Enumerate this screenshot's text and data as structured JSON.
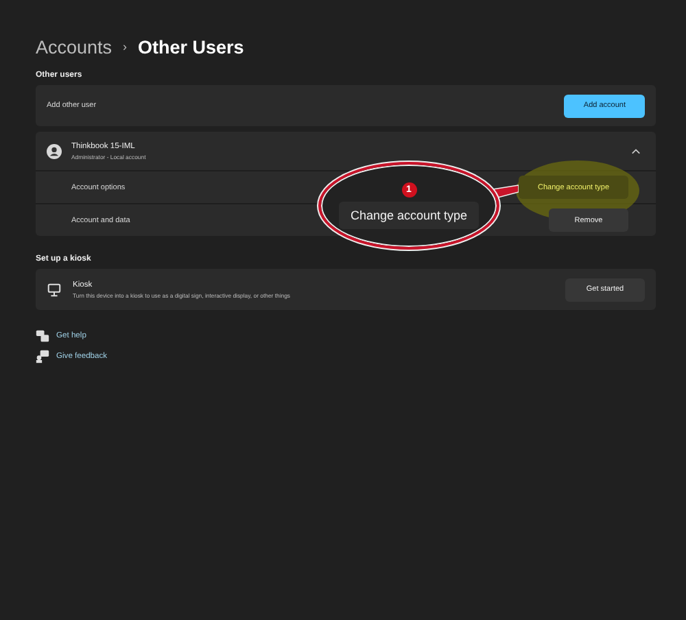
{
  "breadcrumb": {
    "parent": "Accounts",
    "separator": "›",
    "current": "Other Users"
  },
  "other_users": {
    "heading": "Other users",
    "add_row": {
      "label": "Add other user",
      "button": "Add account"
    },
    "user": {
      "name": "Thinkbook 15-IML",
      "subtitle": "Administrator - Local account",
      "expanded": true,
      "rows": [
        {
          "label": "Account options",
          "button": "Change account type",
          "highlighted": true
        },
        {
          "label": "Account and data",
          "button": "Remove",
          "highlighted": false
        }
      ]
    }
  },
  "kiosk": {
    "heading": "Set up a kiosk",
    "title": "Kiosk",
    "description": "Turn this device into a kiosk to use as a digital sign, interactive display, or other things",
    "button": "Get started"
  },
  "links": [
    {
      "kind": "help",
      "label": "Get help"
    },
    {
      "kind": "feedback",
      "label": "Give feedback"
    }
  ],
  "callout": {
    "number": "1",
    "text": "Change account type"
  }
}
